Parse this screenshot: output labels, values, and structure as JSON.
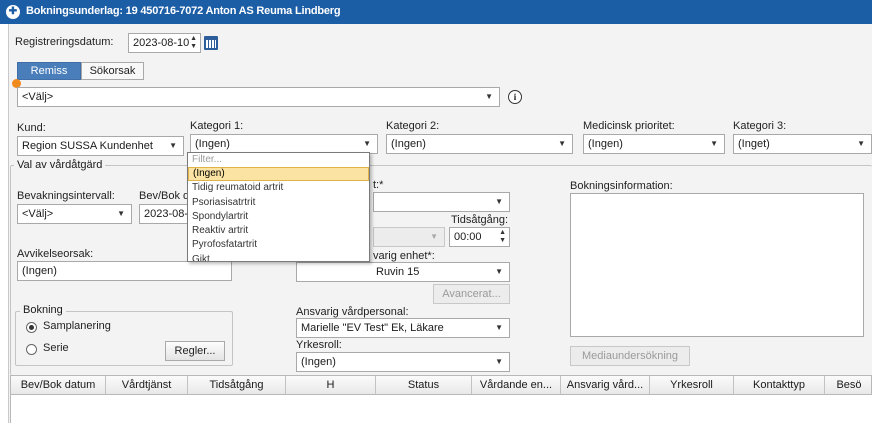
{
  "window": {
    "title": "Bokningsunderlag: 19 450716-7072 Anton AS Reuma Lindberg"
  },
  "registrering": {
    "label": "Registreringsdatum:",
    "value": "2023-08-10"
  },
  "tabs": [
    {
      "label": "Remiss"
    },
    {
      "label": "Sökorsak"
    }
  ],
  "remiss_select": {
    "value": "<Välj>"
  },
  "kund": {
    "label": "Kund:",
    "value": "Region SUSSA Kundenhet"
  },
  "kategori1": {
    "label": "Kategori 1:",
    "value": "(Ingen)",
    "dropdown": {
      "filter_placeholder": "Filter...",
      "options": [
        "(Ingen)",
        "Tidig reumatoid artrit",
        "Psoriasisatrtrit",
        "Spondylartrit",
        "Reaktiv artrit",
        "Pyrofosfatartrit",
        "Gikt"
      ],
      "selected_index": 0
    }
  },
  "kategori2": {
    "label": "Kategori 2:",
    "value": "(Ingen)"
  },
  "medicinsk_prioritet": {
    "label": "Medicinsk prioritet:",
    "value": "(Ingen)"
  },
  "kategori3": {
    "label": "Kategori 3:",
    "value": "(Inget)"
  },
  "val_av_vardatgard": {
    "title": "Val av vårdåtgärd"
  },
  "bevakningsintervall": {
    "label": "Bevakningsintervall:",
    "value": "<Välj>"
  },
  "bev_bok": {
    "label": "Bev/Bok da",
    "value": "2023-08-1("
  },
  "partial_label_t": {
    "text": "t:*"
  },
  "tidsatgang": {
    "label": "Tidsåtgång:",
    "value": "00:00"
  },
  "avvikelseorsak": {
    "label": "Avvikelseorsak:",
    "value": "(Ingen)"
  },
  "ansvarig_enhet": {
    "label": "varig enhet*:",
    "value": "Ruvin 15"
  },
  "avancerat_button": {
    "label": "Avancerat..."
  },
  "bokning": {
    "title": "Bokning",
    "radios": [
      {
        "label": "Samplanering",
        "checked": true
      },
      {
        "label": "Serie",
        "checked": false
      }
    ],
    "regler_button": "Regler..."
  },
  "ansvarig_vardpersonal": {
    "label": "Ansvarig vårdpersonal:",
    "value": "Marielle \"EV Test\" Ek, Läkare"
  },
  "yrkesroll": {
    "label": "Yrkesroll:",
    "value": "(Ingen)"
  },
  "bokningsinformation": {
    "label": "Bokningsinformation:"
  },
  "mediaundersokning_button": {
    "label": "Mediaundersökning"
  },
  "table": {
    "columns": [
      "Bev/Bok datum",
      "Vårdtjänst",
      "Tidsåtgång",
      "H",
      "Status",
      "Vårdande en...",
      "Ansvarig vård...",
      "Yrkesroll",
      "Kontakttyp",
      "Besö"
    ]
  },
  "icons": {
    "app": "app-logo-icon",
    "calendar": "calendar-icon",
    "info": "info-icon",
    "warning": "warning-dot-icon"
  },
  "colors": {
    "titlebar": "#1c5ea6",
    "tab_active": "#4a7ebb",
    "selected_option": "#fbe3a3"
  }
}
